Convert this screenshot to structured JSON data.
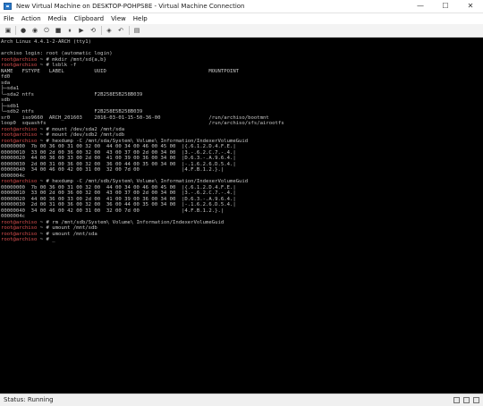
{
  "window": {
    "title": "New Virtual Machine on DESKTOP-POHPS8E - Virtual Machine Connection",
    "minimize_glyph": "—",
    "maximize_glyph": "☐",
    "close_glyph": "✕"
  },
  "menu": [
    "File",
    "Action",
    "Media",
    "Clipboard",
    "View",
    "Help"
  ],
  "toolbar_icons": [
    {
      "name": "ctrl-alt-del-icon",
      "glyph": "▣"
    },
    {
      "name": "start-icon",
      "glyph": "●"
    },
    {
      "name": "turn-off-icon",
      "glyph": "◉"
    },
    {
      "name": "shut-down-icon",
      "glyph": "⏻"
    },
    {
      "name": "save-icon",
      "glyph": "■"
    },
    {
      "name": "pause-icon",
      "glyph": "⏸"
    },
    {
      "name": "resume-icon",
      "glyph": "▶"
    },
    {
      "name": "reset-icon",
      "glyph": "⟲"
    },
    {
      "name": "checkpoint-icon",
      "glyph": "◈"
    },
    {
      "name": "revert-icon",
      "glyph": "↶"
    },
    {
      "name": "enhanced-session-icon",
      "glyph": "▤"
    }
  ],
  "console": {
    "prompt_user": "root@archiso",
    "lines": [
      {
        "p": "",
        "t": "Arch Linux 4.4.1-2-ARCH (tty1)"
      },
      {
        "p": "",
        "t": ""
      },
      {
        "p": "",
        "t": "archiso login: root (automatic login)"
      },
      {
        "p": "root@archiso",
        "t": " ~ # mkdir /mnt/sd{a,b}"
      },
      {
        "p": "root@archiso",
        "t": " ~ # lsblk -f"
      },
      {
        "p": "",
        "t": "NAME   FSTYPE   LABEL          UUID                                  MOUNTPOINT"
      },
      {
        "p": "",
        "t": "fd0"
      },
      {
        "p": "",
        "t": "sda"
      },
      {
        "p": "",
        "t": "├─sda1"
      },
      {
        "p": "",
        "t": "└─sda2 ntfs                    F2B258E5B258B039"
      },
      {
        "p": "",
        "t": "sdb"
      },
      {
        "p": "",
        "t": "├─sdb1"
      },
      {
        "p": "",
        "t": "└─sdb2 ntfs                    F2B258E5B258B039"
      },
      {
        "p": "",
        "t": "sr0    iso9660  ARCH_201603    2016-03-01-15-50-36-00                /run/archiso/bootmnt"
      },
      {
        "p": "",
        "t": "loop0  squashfs                                                      /run/archiso/sfs/airootfs"
      },
      {
        "p": "root@archiso",
        "t": " ~ # mount /dev/sda2 /mnt/sda"
      },
      {
        "p": "root@archiso",
        "t": " ~ # mount /dev/sdb2 /mnt/sdb"
      },
      {
        "p": "root@archiso",
        "t": " ~ # hexdump -C /mnt/sda/System\\ Volume\\ Information/IndexerVolumeGuid"
      },
      {
        "p": "",
        "t": "00000000  7b 00 36 00 31 00 32 00  44 00 34 00 46 00 45 00  |{.6.1.2.D.4.F.E.|"
      },
      {
        "p": "",
        "t": "00000010  33 00 2d 00 36 00 32 00  43 00 37 00 2d 00 34 00  |3.-.6.2.C.7.-.4.|"
      },
      {
        "p": "",
        "t": "00000020  44 00 36 00 33 00 2d 00  41 00 39 00 36 00 34 00  |D.6.3.-.A.9.6.4.|"
      },
      {
        "p": "",
        "t": "00000030  2d 00 31 00 36 00 32 00  36 00 44 00 35 00 34 00  |-.1.6.2.6.D.5.4.|"
      },
      {
        "p": "",
        "t": "00000040  34 00 46 00 42 00 31 00  32 00 7d 00              |4.F.B.1.2.}.|"
      },
      {
        "p": "",
        "t": "0000004c"
      },
      {
        "p": "root@archiso",
        "t": " ~ # hexdump -C /mnt/sdb/System\\ Volume\\ Information/IndexerVolumeGuid"
      },
      {
        "p": "",
        "t": "00000000  7b 00 36 00 31 00 32 00  44 00 34 00 46 00 45 00  |{.6.1.2.D.4.F.E.|"
      },
      {
        "p": "",
        "t": "00000010  33 00 2d 00 36 00 32 00  43 00 37 00 2d 00 34 00  |3.-.6.2.C.7.-.4.|"
      },
      {
        "p": "",
        "t": "00000020  44 00 36 00 33 00 2d 00  41 00 39 00 36 00 34 00  |D.6.3.-.A.9.6.4.|"
      },
      {
        "p": "",
        "t": "00000030  2d 00 31 00 36 00 32 00  36 00 44 00 35 00 34 00  |-.1.6.2.6.D.5.4.|"
      },
      {
        "p": "",
        "t": "00000040  34 00 46 00 42 00 31 00  32 00 7d 00              |4.F.B.1.2.}.|"
      },
      {
        "p": "",
        "t": "0000004c"
      },
      {
        "p": "root@archiso",
        "t": " ~ # rm /mnt/sdb/System\\ Volume\\ Information/IndexerVolumeGuid"
      },
      {
        "p": "root@archiso",
        "t": " ~ # umount /mnt/sdb"
      },
      {
        "p": "root@archiso",
        "t": " ~ # umount /mnt/sda"
      },
      {
        "p": "root@archiso",
        "t": " ~ # _"
      }
    ]
  },
  "status": {
    "text": "Status: Running"
  },
  "colors": {
    "console_bg": "#000000",
    "console_text": "#c7c7c7",
    "prompt_red": "#e05252"
  }
}
